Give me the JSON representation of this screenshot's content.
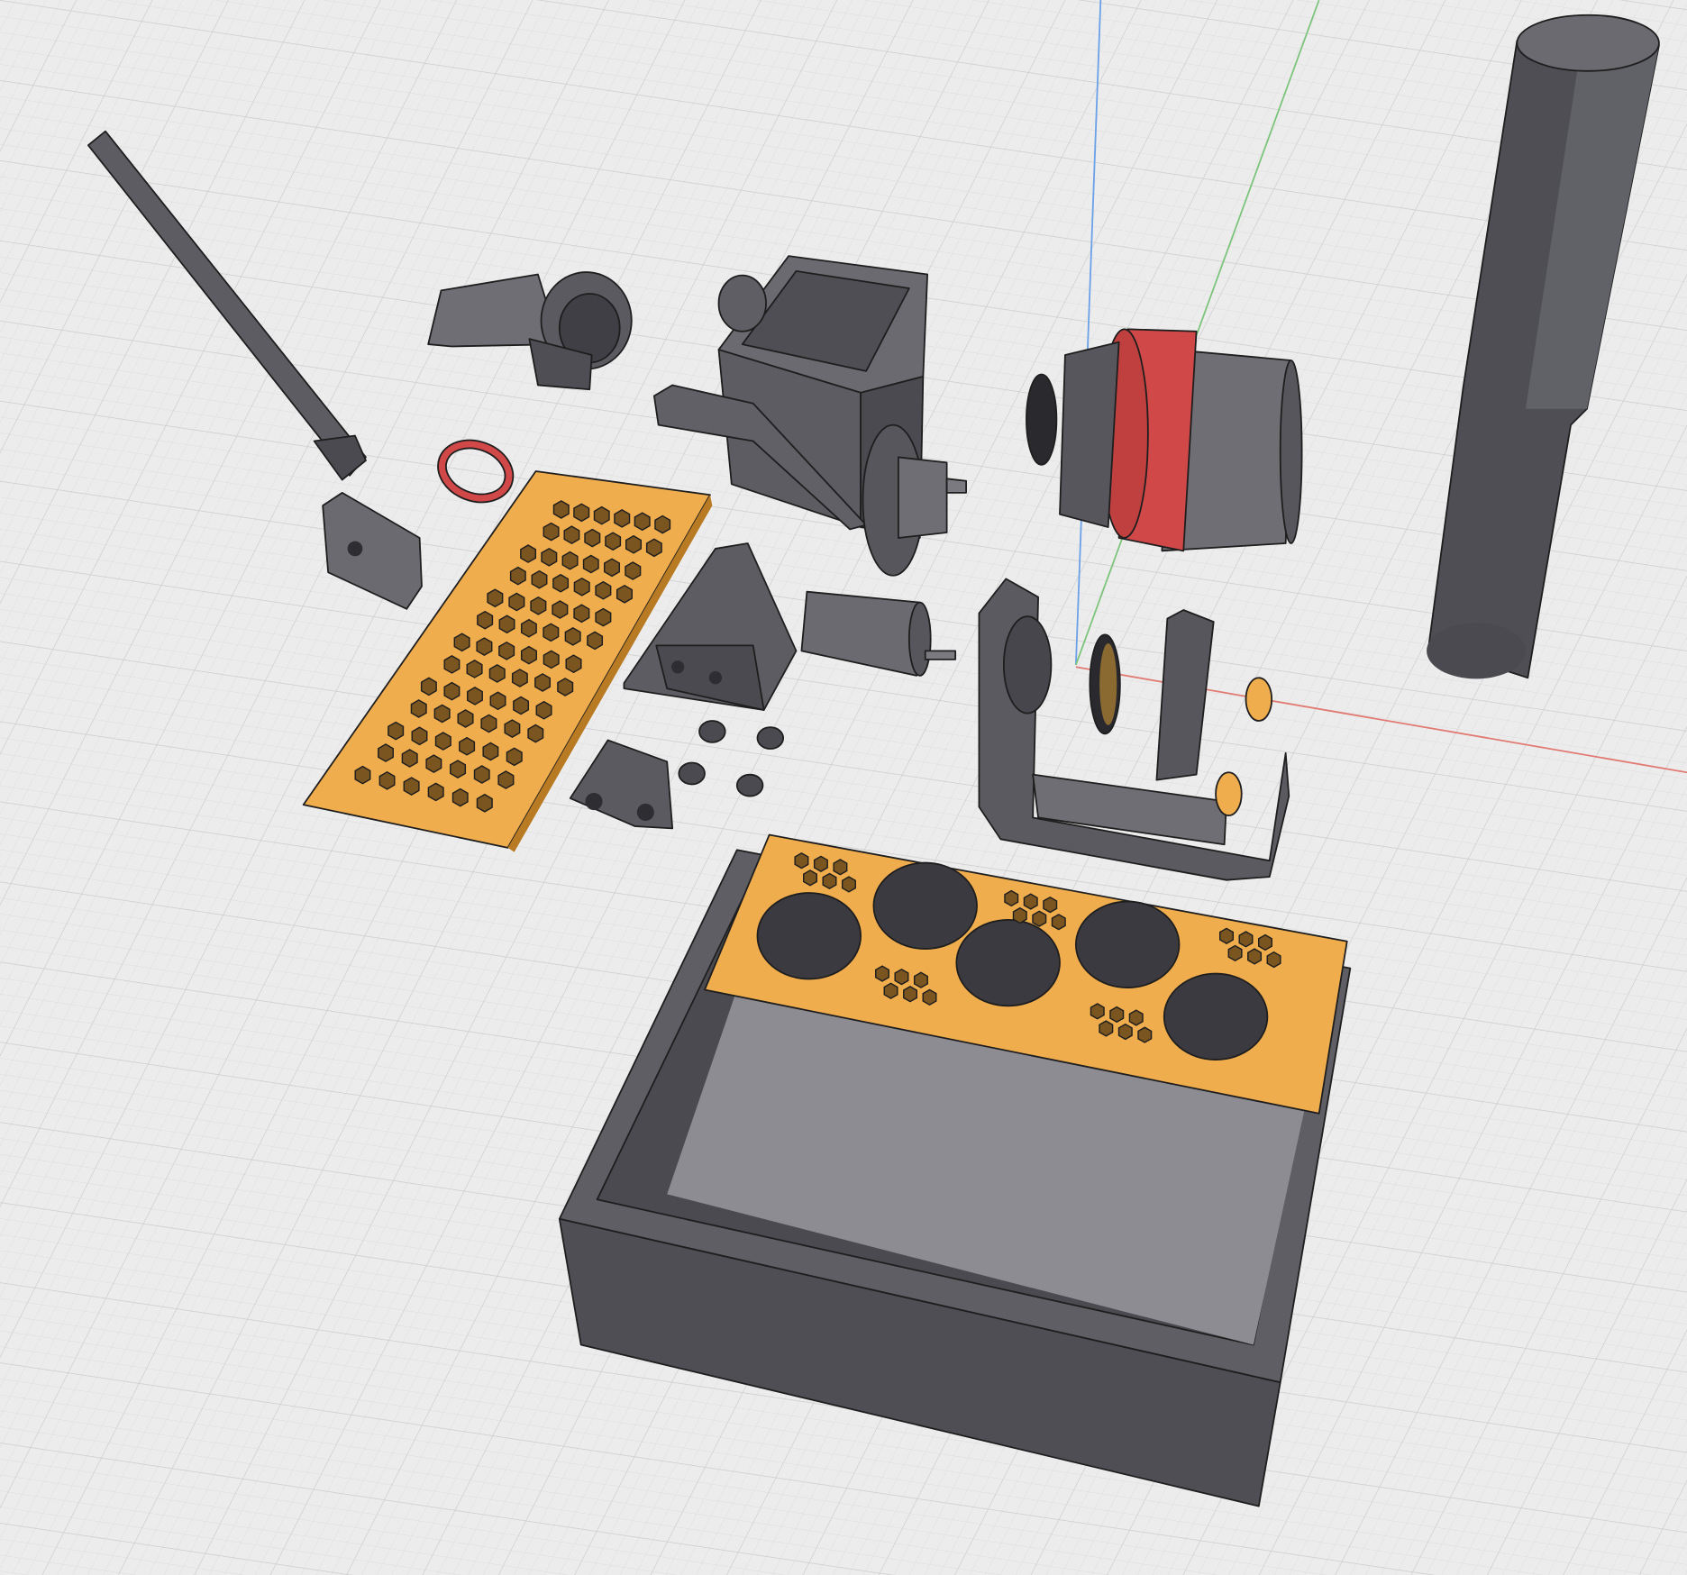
{
  "viewport": {
    "background": "#ececec",
    "grid_color": "#d4d4d4",
    "axis_colors": {
      "x": "#e07a72",
      "y": "#7cc47c",
      "z": "#6aa0e8"
    }
  },
  "materials": {
    "gray_light": "#6e6e74",
    "gray_mid": "#5a5a60",
    "gray_dark": "#46464c",
    "orange": "#f0ad4e",
    "orange_dark": "#b87a22",
    "red": "#d14848"
  },
  "plate_hex_grid": {
    "rows": 13,
    "cols": 6
  },
  "tray_holes": 5
}
